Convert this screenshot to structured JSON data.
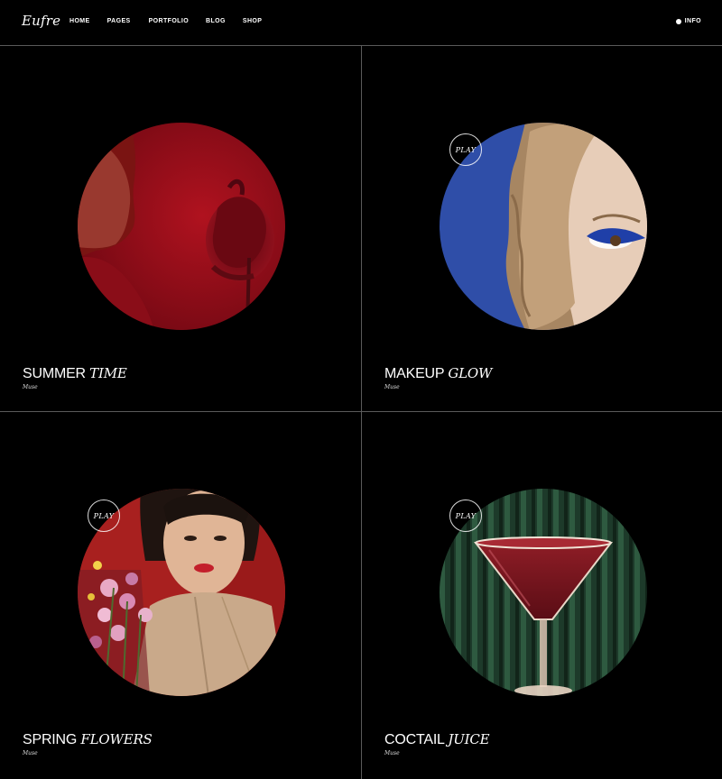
{
  "header": {
    "logo": "Eufre",
    "nav": [
      "HOME",
      "PAGES",
      "PORTFOLIO",
      "BLOG",
      "SHOP"
    ],
    "info_label": "INFO"
  },
  "cards": [
    {
      "title_plain": "SUMMER",
      "title_italic": "TIME",
      "category": "Muse",
      "play": ""
    },
    {
      "title_plain": "MAKEUP",
      "title_italic": "GLOW",
      "category": "Muse",
      "play": "PLAY"
    },
    {
      "title_plain": "SPRING",
      "title_italic": "FLOWERS",
      "category": "Muse",
      "play": "PLAY"
    },
    {
      "title_plain": "COCTAIL",
      "title_italic": "JUICE",
      "category": "Muse",
      "play": "PLAY"
    }
  ],
  "colors": {
    "background": "#000000",
    "divider": "#5a5a5a",
    "red": "#9b0f1c",
    "blue": "#2f4ea8",
    "green": "#1f3a2a"
  }
}
